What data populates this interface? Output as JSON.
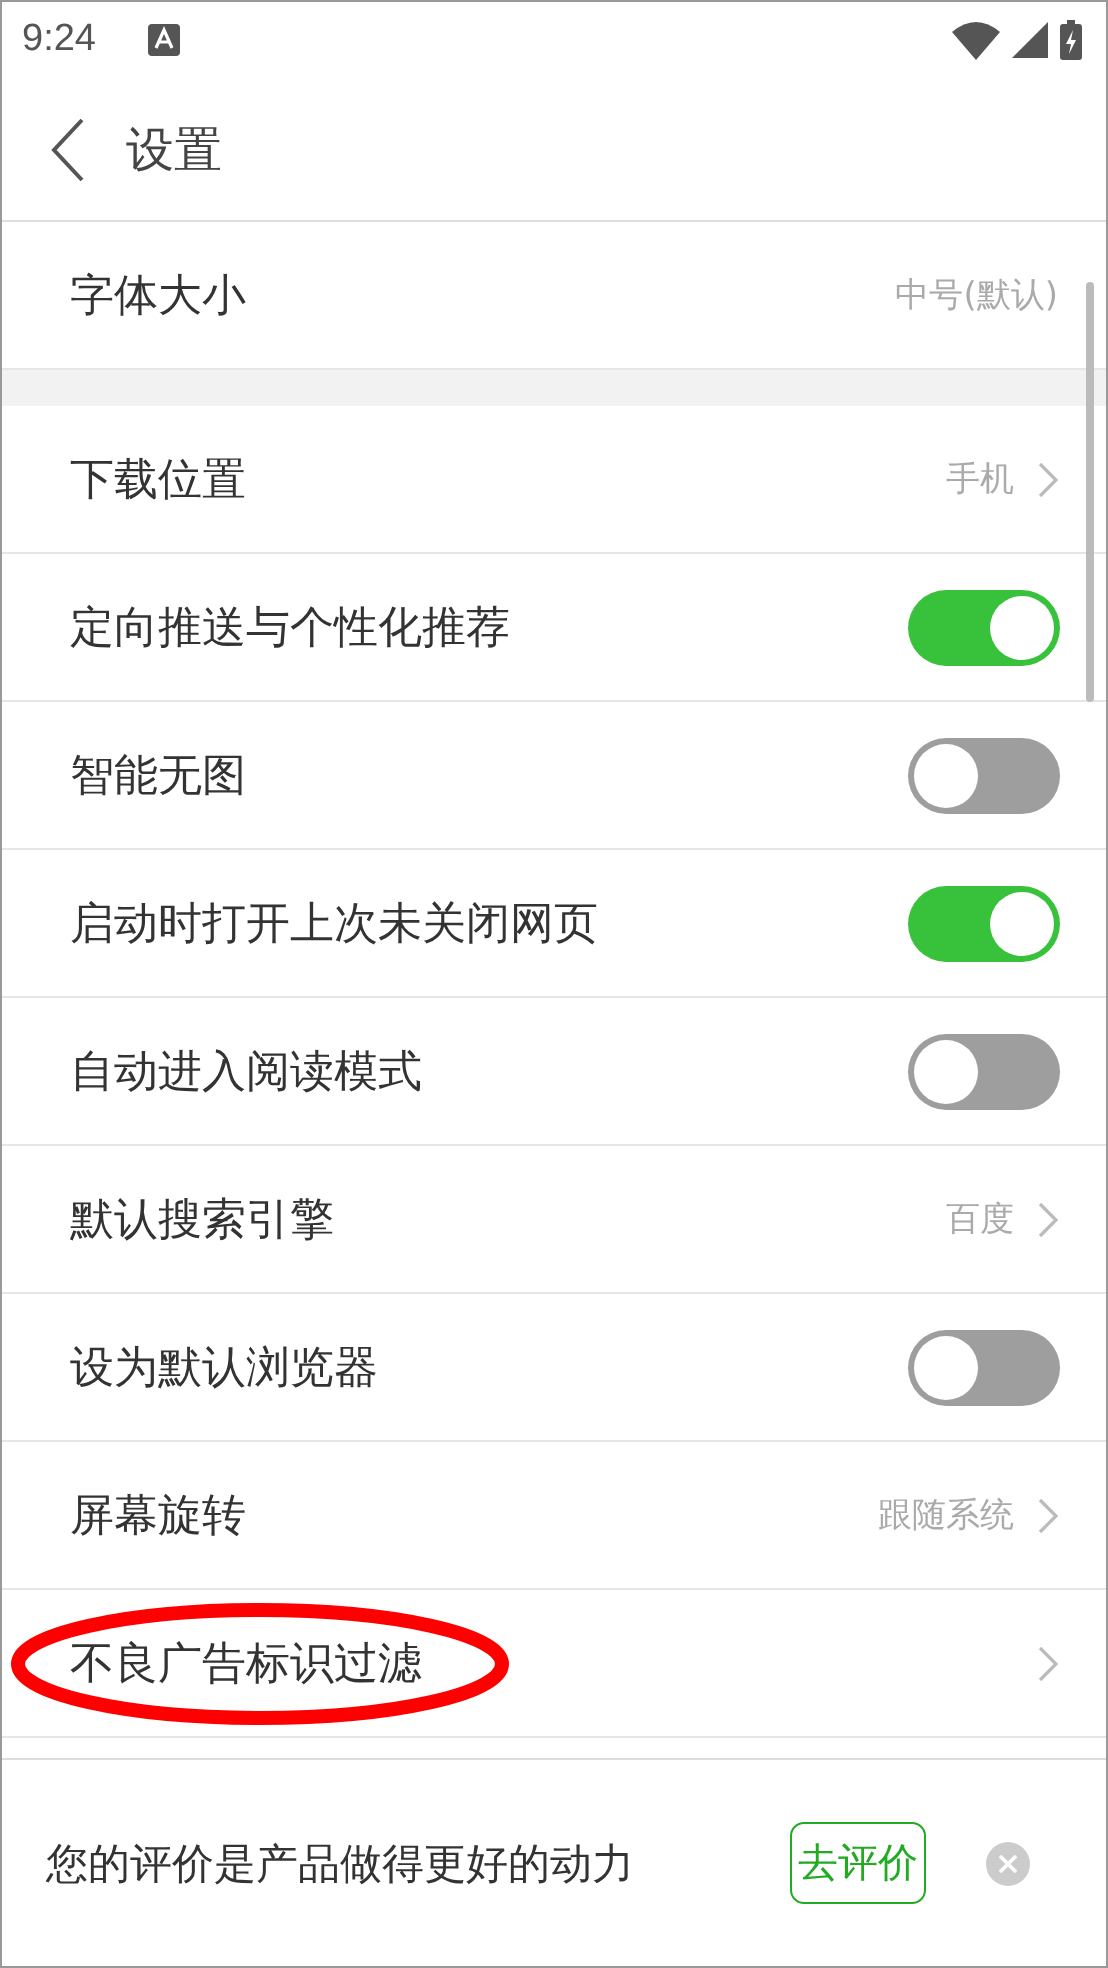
{
  "status_bar": {
    "time": "9:24"
  },
  "header": {
    "title": "设置"
  },
  "groups": [
    {
      "rows": [
        {
          "kind": "info",
          "label": "字体大小",
          "value": "中号(默认)"
        }
      ]
    },
    {
      "rows": [
        {
          "kind": "link",
          "label": "下载位置",
          "value": "手机"
        },
        {
          "kind": "toggle",
          "label": "定向推送与个性化推荐",
          "on": true
        },
        {
          "kind": "toggle",
          "label": "智能无图",
          "on": false
        },
        {
          "kind": "toggle",
          "label": "启动时打开上次未关闭网页",
          "on": true
        },
        {
          "kind": "toggle",
          "label": "自动进入阅读模式",
          "on": false
        },
        {
          "kind": "link",
          "label": "默认搜索引擎",
          "value": "百度"
        },
        {
          "kind": "toggle",
          "label": "设为默认浏览器",
          "on": false
        },
        {
          "kind": "link",
          "label": "屏幕旋转",
          "value": "跟随系统"
        },
        {
          "kind": "link",
          "label": "不良广告标识过滤",
          "annotated": true
        }
      ]
    }
  ],
  "rating_bar": {
    "message": "您的评价是产品做得更好的动力",
    "button": "去评价"
  }
}
